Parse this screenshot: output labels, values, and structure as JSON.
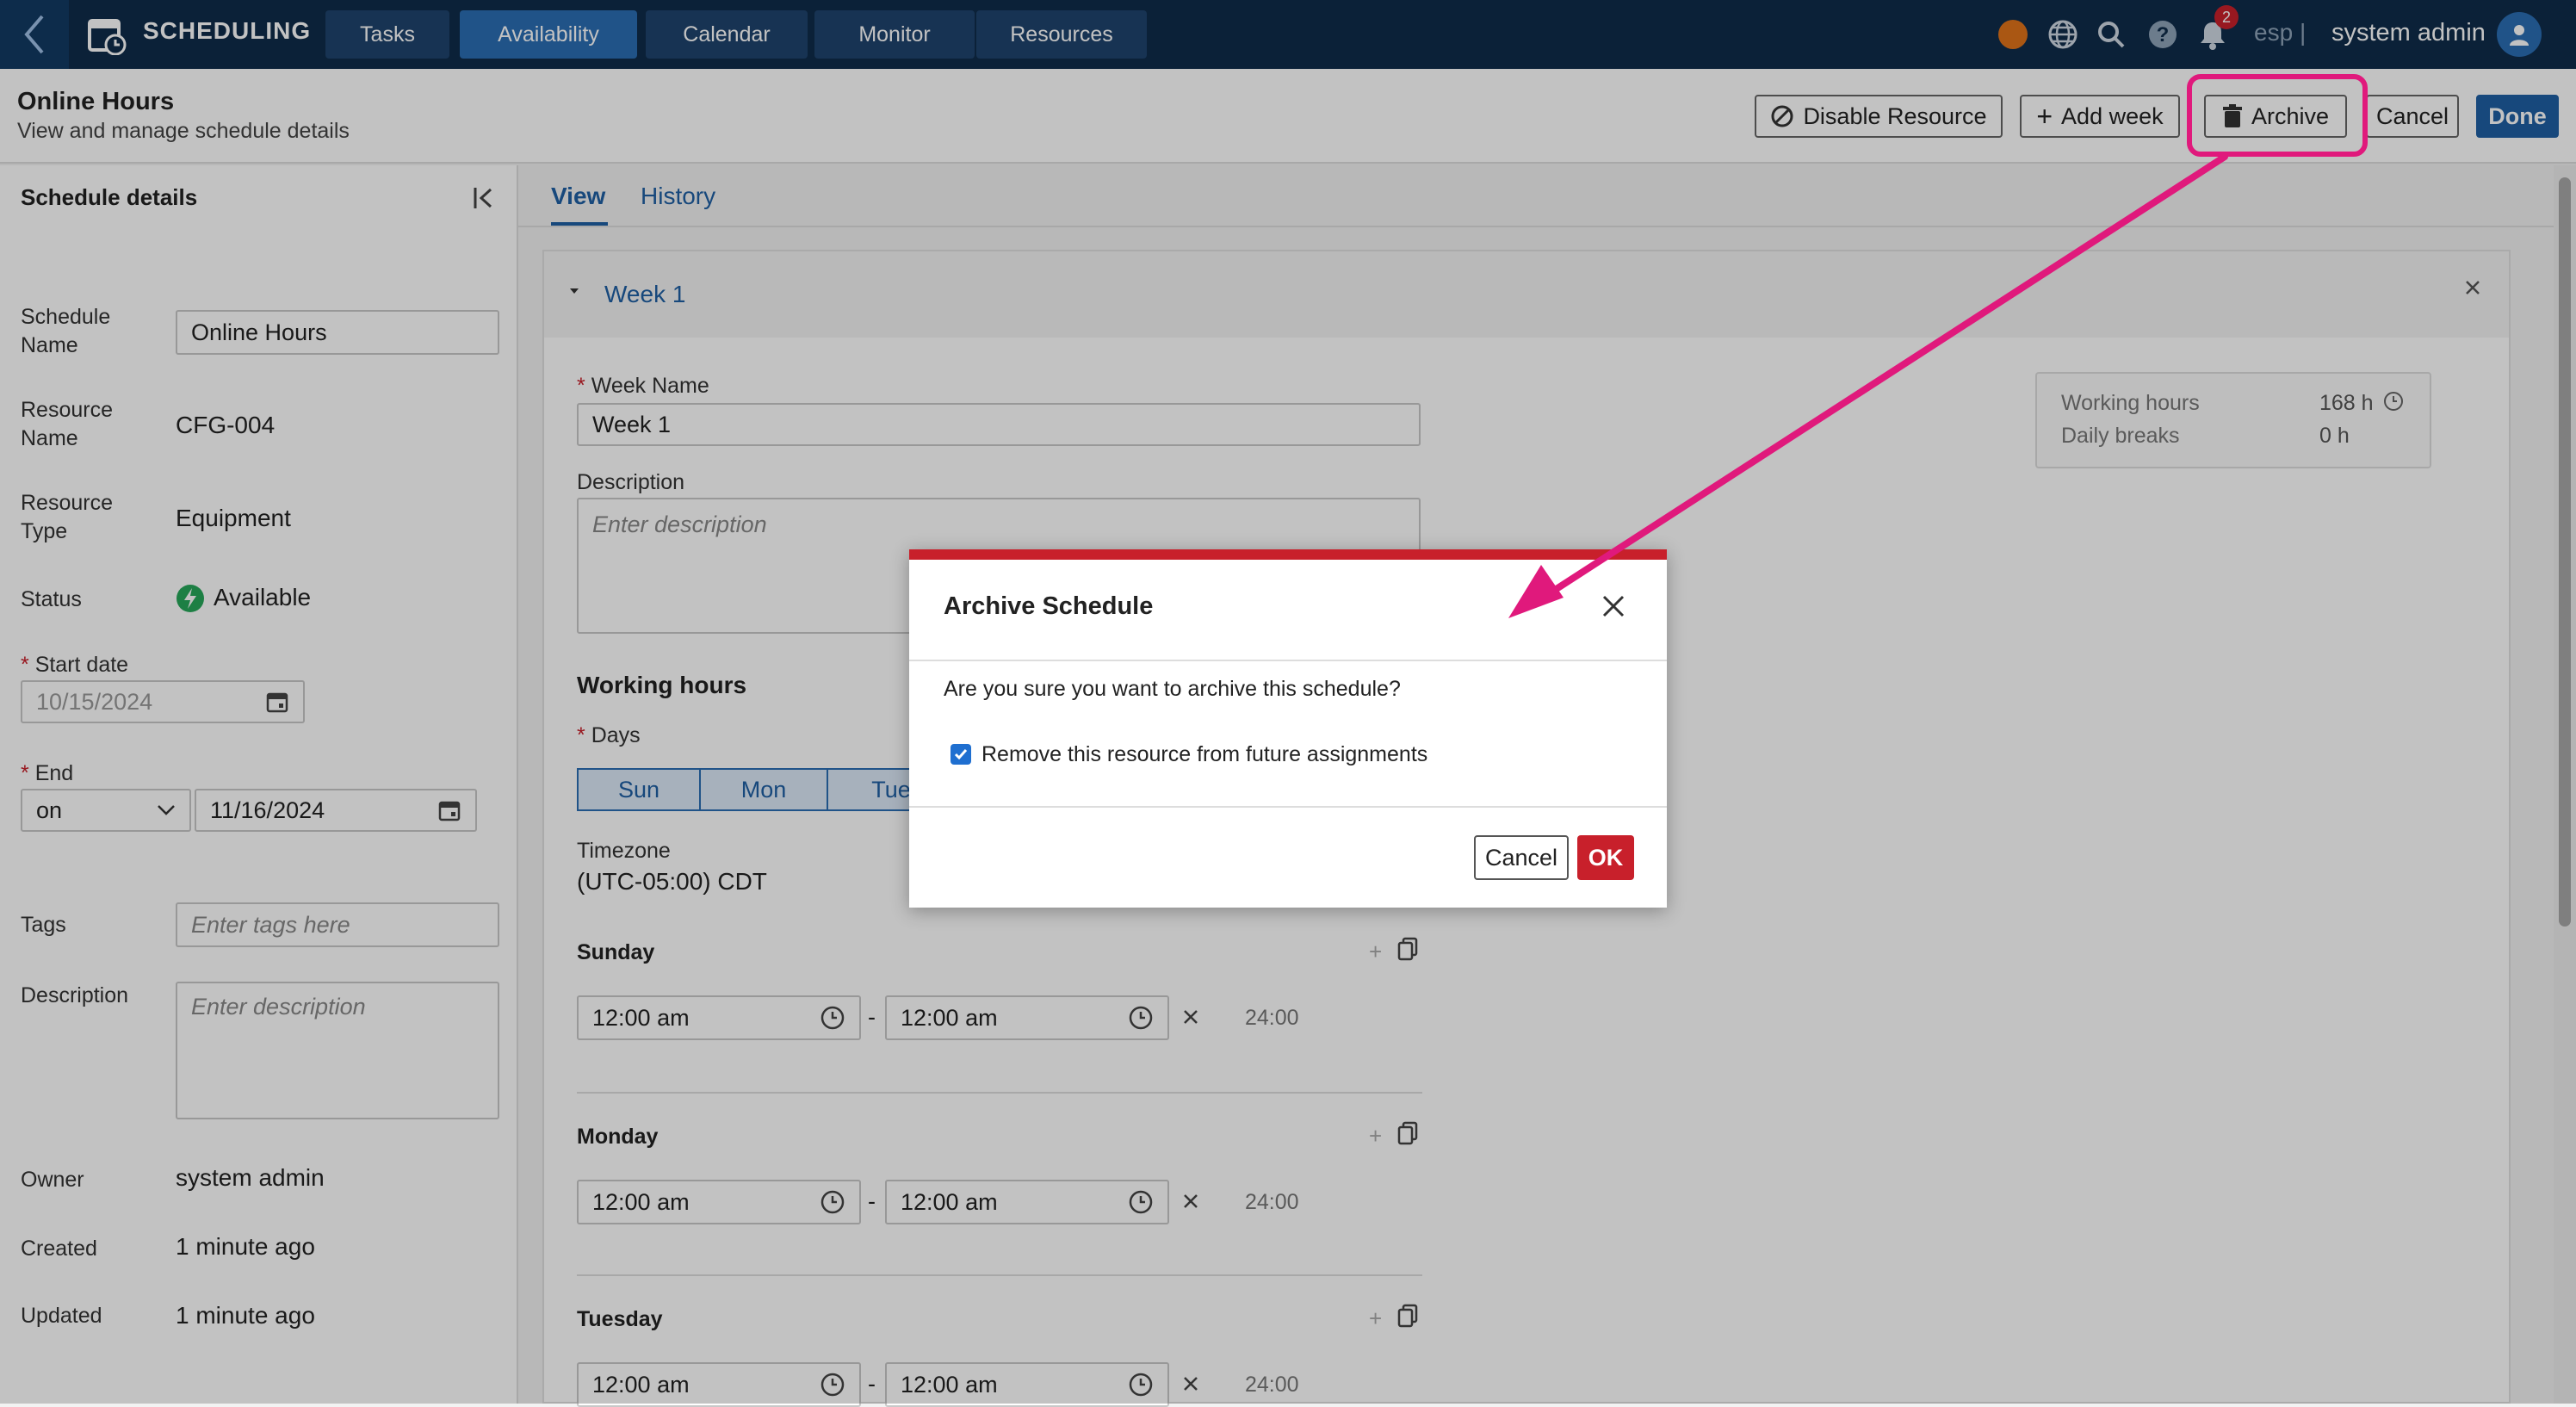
{
  "app": {
    "title": "SCHEDULING"
  },
  "nav": [
    {
      "label": "Tasks"
    },
    {
      "label": "Availability",
      "active": true
    },
    {
      "label": "Calendar"
    },
    {
      "label": "Monitor"
    },
    {
      "label": "Resources"
    }
  ],
  "topbar": {
    "notification_count": "2",
    "lang": "esp",
    "separator": "|",
    "user": "system admin"
  },
  "header": {
    "title": "Online Hours",
    "subtitle": "View and manage schedule details",
    "buttons": {
      "disable": "Disable Resource",
      "add_week": "Add week",
      "archive": "Archive",
      "cancel": "Cancel",
      "done": "Done"
    }
  },
  "details": {
    "title": "Schedule details",
    "schedule_name_label": "Schedule Name",
    "schedule_name": "Online Hours",
    "resource_name_label": "Resource Name",
    "resource_name": "CFG-004",
    "resource_type_label": "Resource Type",
    "resource_type": "Equipment",
    "status_label": "Status",
    "status": "Available",
    "start_label": "Start date",
    "start_date": "10/15/2024",
    "end_label": "End",
    "end_mode": "on",
    "end_date": "11/16/2024",
    "tags_label": "Tags",
    "tags_placeholder": "Enter tags here",
    "description_label": "Description",
    "description_placeholder": "Enter description",
    "owner_label": "Owner",
    "owner": "system admin",
    "created_label": "Created",
    "created": "1 minute ago",
    "updated_label": "Updated",
    "updated": "1 minute ago"
  },
  "tabs": [
    {
      "label": "View",
      "active": true
    },
    {
      "label": "History"
    }
  ],
  "week": {
    "title": "Week 1",
    "name_label": "Week Name",
    "name": "Week 1",
    "description_label": "Description",
    "description_placeholder": "Enter description",
    "working_hours_title": "Working hours",
    "days_label": "Days",
    "days": [
      "Sun",
      "Mon",
      "Tue"
    ],
    "timezone_label": "Timezone",
    "timezone": "(UTC-05:00) CDT",
    "summary": {
      "working_hours_label": "Working hours",
      "working_hours": "168 h",
      "daily_breaks_label": "Daily breaks",
      "daily_breaks": "0 h"
    },
    "schedule": [
      {
        "day": "Sunday",
        "start": "12:00 am",
        "sep": "-",
        "end": "12:00 am",
        "duration": "24:00"
      },
      {
        "day": "Monday",
        "start": "12:00 am",
        "sep": "-",
        "end": "12:00 am",
        "duration": "24:00"
      },
      {
        "day": "Tuesday",
        "start": "12:00 am",
        "sep": "-",
        "end": "12:00 am",
        "duration": "24:00"
      }
    ]
  },
  "dialog": {
    "title": "Archive Schedule",
    "message": "Are you sure you want to archive this schedule?",
    "checkbox_label": "Remove this resource from future assignments",
    "checkbox_checked": true,
    "cancel": "Cancel",
    "ok": "OK"
  },
  "colors": {
    "nav_bg": "#0f2c4a",
    "accent": "#1f5fa3",
    "danger": "#c8202b",
    "highlight": "#e0197c",
    "available": "#27a85a"
  }
}
